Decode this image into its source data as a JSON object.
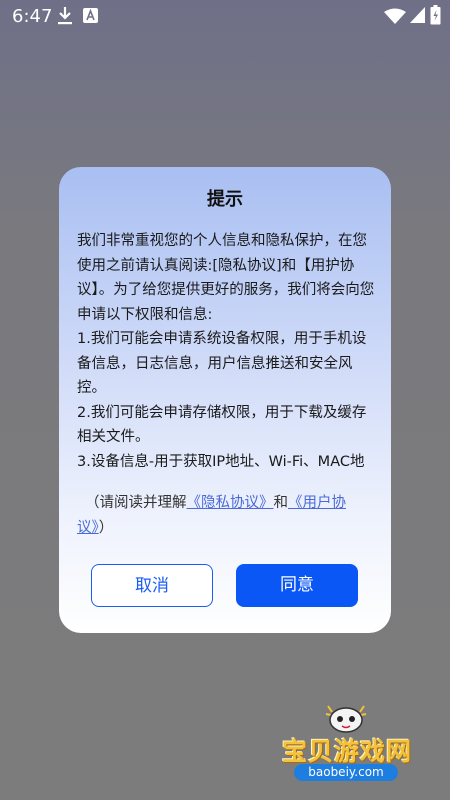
{
  "status_bar": {
    "time": "6:47"
  },
  "dialog": {
    "title": "提示",
    "paragraphs": [
      "我们非常重视您的个人信息和隐私保护，在您使用之前请认真阅读:[隐私协议]和【用护协议】。为了给您提供更好的服务，我们将会向您申请以下权限和信息:",
      "1.我们可能会申请系统设备权限，用于手机设备信息，日志信息，用户信息推送和安全风控。",
      "2.我们可能会申请存储权限，用于下载及缓存相关文件。",
      "3.设备信息-用于获取IP地址、Wi-Fi、MAC地"
    ],
    "agree_prefix": "（请阅读并理解",
    "privacy_link": "《隐私协议》",
    "agree_and": "和",
    "user_link": "《用户协议》",
    "agree_suffix": "）",
    "cancel_label": "取消",
    "agree_label": "同意"
  },
  "watermark": {
    "brand": "宝贝游戏网",
    "url": "baobeiy.com"
  },
  "colors": {
    "primary": "#0b57f5",
    "link": "#4a6ad8"
  }
}
